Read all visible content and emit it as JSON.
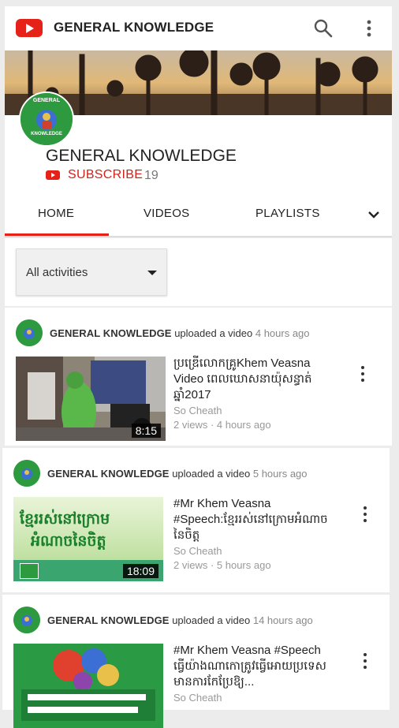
{
  "app": {
    "title": "GENERAL KNOWLEDGE"
  },
  "channel": {
    "name": "GENERAL KNOWLEDGE",
    "avatar_text_top": "GENERAL",
    "avatar_text_bottom": "KNOWLEDGE",
    "subscribe_label": "SUBSCRIBE",
    "subscriber_count": "19"
  },
  "tabs": [
    {
      "label": "HOME",
      "selected": true
    },
    {
      "label": "VIDEOS",
      "selected": false
    },
    {
      "label": "PLAYLISTS",
      "selected": false
    }
  ],
  "filter": {
    "selected": "All activities"
  },
  "activities": [
    {
      "channel": "GENERAL KNOWLEDGE",
      "verb": "uploaded a video",
      "time": "4 hours ago",
      "title": "ប្រឌ្រើលោកគ្រូKhem Veasna Video ពេលឃោសនាយ៉ុសន្ធាត់ឆ្នាំ2017",
      "owner": "So Cheath",
      "meta": "2 views · 4 hours ago",
      "duration": "8:15"
    },
    {
      "channel": "GENERAL KNOWLEDGE",
      "verb": "uploaded a video",
      "time": "5 hours ago",
      "title": "#Mr Khem Veasna #Speech:ខ្មែររស់នៅក្រោមអំណាចនៃចិត្ត",
      "owner": "So Cheath",
      "meta": "2 views · 5 hours ago",
      "duration": "18:09",
      "thumb_text_1": "ខ្មែររស់នៅក្រោម",
      "thumb_text_2": "អំណាចនៃចិត្ត"
    },
    {
      "channel": "GENERAL KNOWLEDGE",
      "verb": "uploaded a video",
      "time": "14 hours ago",
      "title": "#Mr Khem Veasna #Speech ធ្វើយ៉ាងណាកោត្រូវធ្វើអោយប្រទេសមានការកែប្រែឱ្យ...",
      "owner": "So Cheath",
      "meta": "",
      "duration": ""
    }
  ],
  "colors": {
    "brand_red": "#e62117",
    "avatar_green": "#2d9a3f"
  }
}
